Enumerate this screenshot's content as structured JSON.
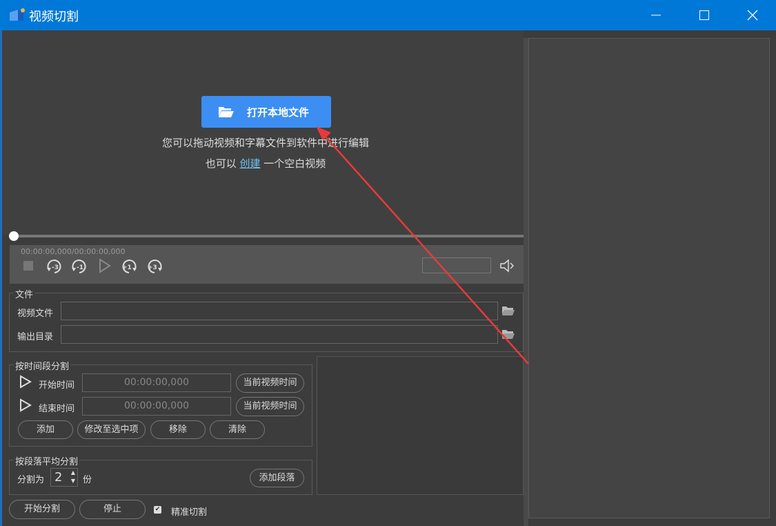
{
  "window": {
    "title": "视频切割"
  },
  "player": {
    "open_button": "打开本地文件",
    "hint_line1": "您可以拖动视频和字幕文件到软件中进行编辑",
    "hint_line2_pre": "也可以 ",
    "hint_link": "创建",
    "hint_line2_post": " 一个空白视频",
    "time": "00:00:00,000/00:00:00,000",
    "skip": [
      "-3",
      "-1",
      "+1",
      "+3"
    ]
  },
  "file_group": {
    "title": "文件",
    "video_label": "视频文件",
    "output_label": "输出目录"
  },
  "time_group": {
    "title": "按时间段分割",
    "start_label": "开始时间",
    "end_label": "结束时间",
    "start_value": "00:00:00,000",
    "end_value": "00:00:00,000",
    "current_btn": "当前视频时间",
    "add": "添加",
    "modify": "修改至选中项",
    "remove": "移除",
    "clear": "清除"
  },
  "para_group": {
    "title": "按段落平均分割",
    "split_into": "分割为",
    "count": "2",
    "unit": "份",
    "add_para": "添加段落"
  },
  "bottom": {
    "start": "开始分割",
    "stop": "停止",
    "precise": "精准切割",
    "precise_checked": true
  },
  "colors": {
    "titlebar": "#0078d7",
    "accent": "#3c8ef3",
    "arrow": "#e83a3a"
  }
}
